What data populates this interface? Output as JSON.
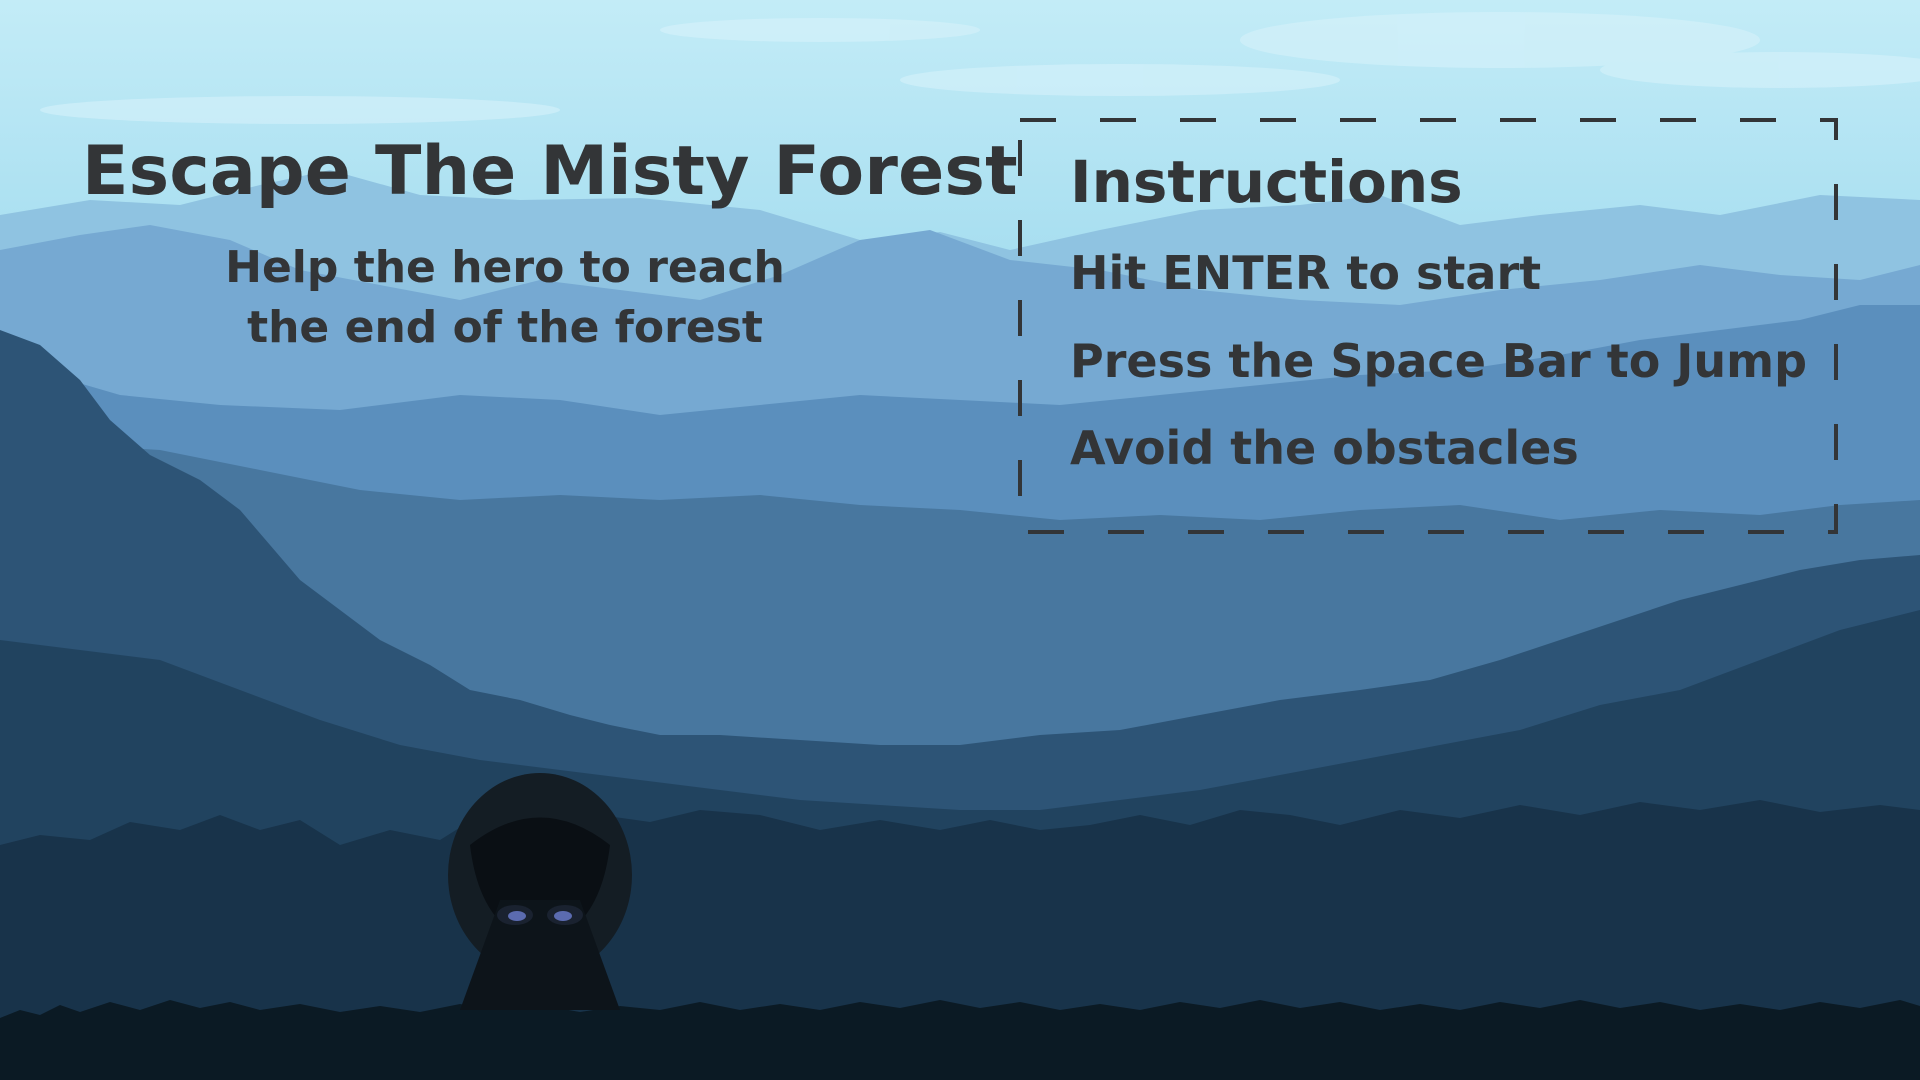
{
  "game": {
    "title": "Escape The Misty Forest",
    "subtitle_lines": [
      "Help the hero to reach",
      "the end of the forest"
    ]
  },
  "instructions": {
    "heading": "Instructions",
    "items": [
      "Hit ENTER to start",
      "Press the Space Bar to Jump",
      "Avoid the obstacles"
    ]
  },
  "colors": {
    "text": "#333537",
    "sky_top": "#bfeaf6",
    "ground": "#0b1a24"
  },
  "icons": {
    "hero": "hooded-hero-icon"
  }
}
